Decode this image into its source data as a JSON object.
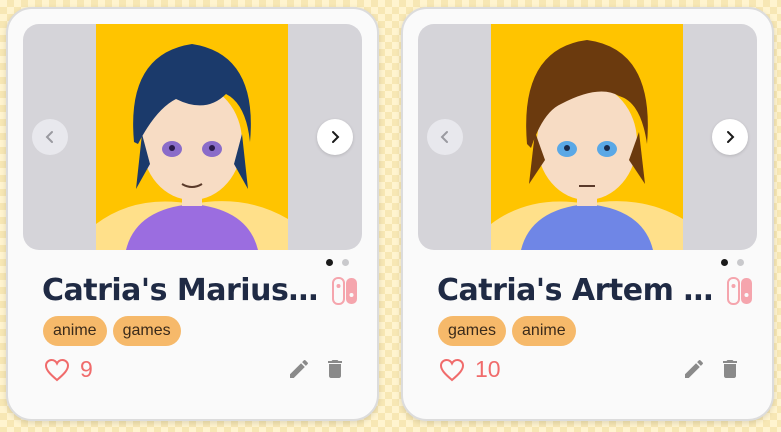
{
  "colors": {
    "title": "#1f2a44",
    "tag_bg": "#f6b96a",
    "like": "#f06b6b",
    "switch": "#f5a5ad",
    "action": "#8a8a8a",
    "portrait_bg": "#ffc400"
  },
  "cards": [
    {
      "title": "Catria's Marius -...",
      "platform_icon": "nintendo-switch-icon",
      "tags": [
        "anime",
        "games"
      ],
      "likes": "9",
      "carousel": {
        "total_slides": 2,
        "active_slide": 1
      },
      "hair_color": "#1b3a6b",
      "eye_color": "#8a6cc9"
    },
    {
      "title": "Catria's Artem -...",
      "platform_icon": "nintendo-switch-icon",
      "tags": [
        "games",
        "anime"
      ],
      "likes": "10",
      "carousel": {
        "total_slides": 2,
        "active_slide": 1
      },
      "hair_color": "#6b3a0e",
      "eye_color": "#5aa8e6"
    }
  ]
}
